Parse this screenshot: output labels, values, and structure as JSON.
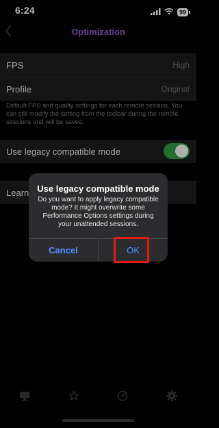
{
  "status_bar": {
    "time": "6:24",
    "battery": "99",
    "icons": [
      "signal-icon",
      "wifi-icon",
      "battery-icon"
    ]
  },
  "nav": {
    "back_icon": "chevron-left-icon",
    "title": "Optimization"
  },
  "settings": {
    "fps_label": "FPS",
    "fps_value": "High",
    "profile_label": "Profile",
    "profile_value": "Original",
    "footnote": "Default FPS and quality settings for each remote session. You can still modify the setting from the toolbar during the remote sessions and will be saved.",
    "legacy_label": "Use legacy compatible mode",
    "legacy_enabled": true,
    "learn_label": "Learn"
  },
  "dialog": {
    "title": "Use legacy compatible mode",
    "message": "Do you want to apply legacy compatible mode? It might overwrite some Performance Options settings during your unattended sessions.",
    "cancel_label": "Cancel",
    "ok_label": "OK"
  },
  "tab_bar": {
    "tabs": [
      {
        "icon": "monitor-icon"
      },
      {
        "icon": "star-icon"
      },
      {
        "icon": "speedometer-icon"
      },
      {
        "icon": "gear-icon"
      }
    ]
  },
  "colors": {
    "accent": "#8e59c9",
    "link": "#4a90ff",
    "toggle_on": "#2e9c42",
    "highlight": "#e01818"
  }
}
